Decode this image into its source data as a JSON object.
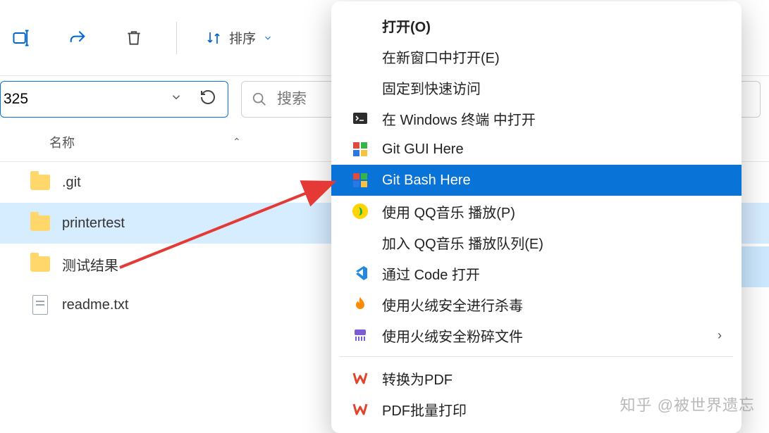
{
  "toolbar": {
    "sort_label": "排序"
  },
  "address": {
    "value": "325"
  },
  "search": {
    "placeholder": "搜索"
  },
  "list": {
    "header_name": "名称",
    "items": [
      {
        "name": ".git",
        "type": "folder"
      },
      {
        "name": "printertest",
        "type": "folder",
        "selected": true
      },
      {
        "name": "测试结果",
        "type": "folder"
      },
      {
        "name": "readme.txt",
        "type": "file"
      }
    ]
  },
  "context_menu": {
    "items": [
      {
        "label": "打开(O)",
        "icon": null,
        "bold": true
      },
      {
        "label": "在新窗口中打开(E)",
        "icon": null
      },
      {
        "label": "固定到快速访问",
        "icon": null
      },
      {
        "label": "在 Windows 终端 中打开",
        "icon": "terminal"
      },
      {
        "label": "Git GUI Here",
        "icon": "gitgui"
      },
      {
        "label": "Git Bash Here",
        "icon": "gitbash",
        "highlight": true
      },
      {
        "label": "使用 QQ音乐 播放(P)",
        "icon": "qqmusic"
      },
      {
        "label": "加入 QQ音乐 播放队列(E)",
        "icon": null
      },
      {
        "label": "通过 Code 打开",
        "icon": "vscode"
      },
      {
        "label": "使用火绒安全进行杀毒",
        "icon": "huorong"
      },
      {
        "label": "使用火绒安全粉碎文件",
        "icon": "shred",
        "submenu": true
      },
      {
        "separator": true
      },
      {
        "label": "转换为PDF",
        "icon": "wps"
      },
      {
        "label": "PDF批量打印",
        "icon": "wps"
      }
    ]
  },
  "watermark": "知乎 @被世界遗忘"
}
